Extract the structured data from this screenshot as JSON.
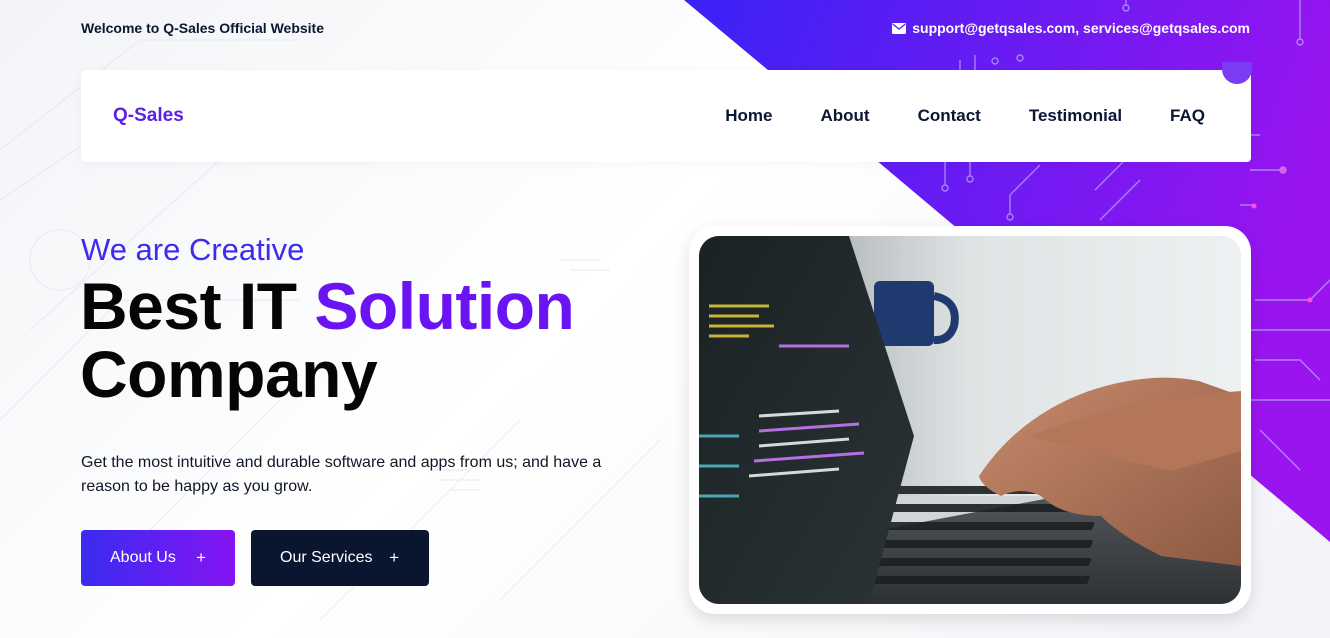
{
  "topbar": {
    "welcome": "Welcome to Q-Sales Official Website",
    "email_icon": "envelope-icon",
    "emails": "support@getqsales.com, services@getqsales.com"
  },
  "nav": {
    "brand": "Q-Sales",
    "items": [
      {
        "label": "Home"
      },
      {
        "label": "About"
      },
      {
        "label": "Contact"
      },
      {
        "label": "Testimonial"
      },
      {
        "label": "FAQ"
      }
    ]
  },
  "hero": {
    "eyebrow": "We are Creative",
    "headline_part1": "Best IT ",
    "headline_accent": "Solution",
    "headline_part2": "Company",
    "description": "Get the most intuitive and durable software and apps from us; and have a reason to be happy as you grow.",
    "buttons": [
      {
        "label": "About Us",
        "icon": "+"
      },
      {
        "label": "Our Services",
        "icon": "+"
      }
    ],
    "image_subject": "hands typing on laptop with code on screen"
  },
  "colors": {
    "brand_purple": "#5b21e6",
    "accent_blue": "#3b2cf0",
    "accent_violet": "#6a14f3",
    "dark_navy": "#0a1530",
    "bg_gradient_start": "#3a22f5",
    "bg_gradient_end": "#9a14f0"
  }
}
